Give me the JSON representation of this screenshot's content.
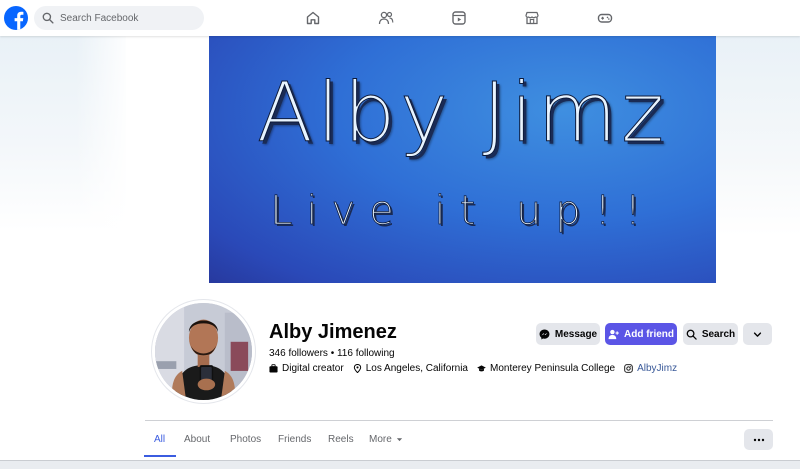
{
  "topbar": {
    "search_placeholder": "Search Facebook",
    "nav_icons": [
      "home-icon",
      "friends-icon",
      "video-icon",
      "marketplace-icon",
      "gaming-icon"
    ]
  },
  "cover": {
    "title": "Alby Jimz",
    "tagline": "Live it up!!"
  },
  "profile": {
    "name": "Alby Jimenez",
    "follow_summary": "346 followers • 116 following",
    "info": {
      "category": "Digital creator",
      "location": "Los Angeles, California",
      "education": "Monterey Peninsula College",
      "instagram": "AlbyJimz"
    }
  },
  "actions": {
    "message": "Message",
    "add_friend": "Add friend",
    "search": "Search"
  },
  "tabs": {
    "all": "All",
    "about": "About",
    "photos": "Photos",
    "friends": "Friends",
    "reels": "Reels",
    "more": "More"
  },
  "colors": {
    "brand": "#0866ff",
    "primary_button": "#5b55e6",
    "active_tab": "#3b5ce0",
    "link": "#385898"
  }
}
